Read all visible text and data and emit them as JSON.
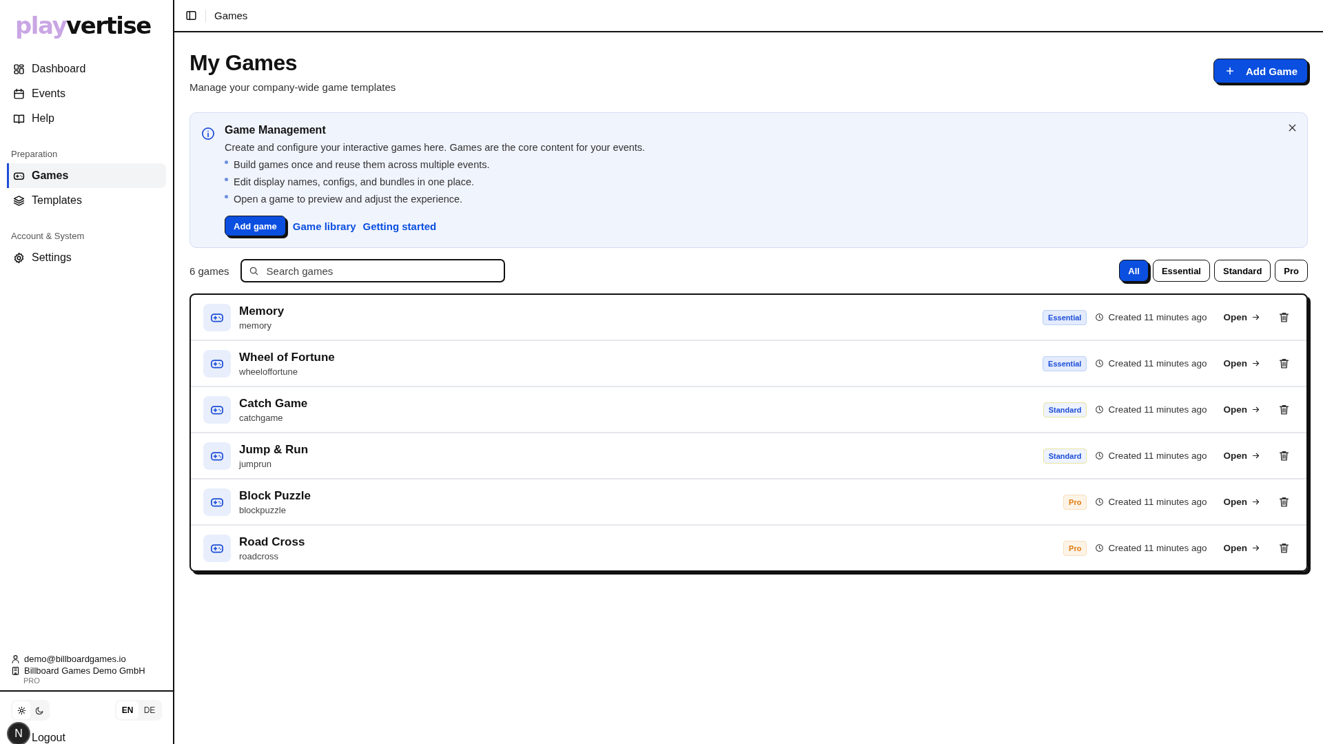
{
  "logo": {
    "part_1": "play",
    "part_2": "vertise"
  },
  "nav": [
    {
      "label": "Dashboard",
      "selected": false
    },
    {
      "label": "Events",
      "selected": false
    },
    {
      "label": "Help",
      "selected": false
    }
  ],
  "sections": [
    {
      "title": "Preparation",
      "items": [
        {
          "label": "Games",
          "selected": true
        },
        {
          "label": "Templates",
          "selected": false
        }
      ]
    },
    {
      "title": "Account & System",
      "items": [
        {
          "label": "Settings",
          "selected": false
        }
      ]
    }
  ],
  "account": {
    "email": "demo@billboardgames.io",
    "company": "Billboard Games Demo GmbH",
    "plan": "PRO"
  },
  "theme": [
    {
      "kind": "light",
      "selected": true
    },
    {
      "kind": "dark",
      "selected": false
    }
  ],
  "languages": [
    {
      "label": "EN",
      "selected": true
    },
    {
      "label": "DE",
      "selected": false
    }
  ],
  "logout": "Logout",
  "avatar": "N",
  "breadcrumb": "Games",
  "page": {
    "title": "My Games",
    "subtitle": "Manage your company-wide game templates",
    "add_button": "Add Game"
  },
  "info": {
    "title": "Game Management",
    "text": "Create and configure your interactive games here. Games are the core content for your events.",
    "bullets": [
      "Build games once and reuse them across multiple events.",
      "Edit display names, configs, and bundles in one place.",
      "Open a game to preview and adjust the experience."
    ],
    "button": "Add game",
    "links": [
      "Game library",
      "Getting started"
    ]
  },
  "count": "6 games",
  "search": {
    "placeholder": "Search games"
  },
  "filters": [
    {
      "label": "All",
      "selected": true
    },
    {
      "label": "Essential",
      "selected": false
    },
    {
      "label": "Standard",
      "selected": false
    },
    {
      "label": "Pro",
      "selected": false
    }
  ],
  "games": [
    {
      "name": "Memory",
      "slug": "memory",
      "tier": {
        "label": "Essential",
        "kind": "essential"
      },
      "created": "Created 11 minutes ago",
      "action": "Open"
    },
    {
      "name": "Wheel of Fortune",
      "slug": "wheeloffortune",
      "tier": {
        "label": "Essential",
        "kind": "essential"
      },
      "created": "Created 11 minutes ago",
      "action": "Open"
    },
    {
      "name": "Catch Game",
      "slug": "catchgame",
      "tier": {
        "label": "Standard",
        "kind": "standard"
      },
      "created": "Created 11 minutes ago",
      "action": "Open"
    },
    {
      "name": "Jump & Run",
      "slug": "jumprun",
      "tier": {
        "label": "Standard",
        "kind": "standard"
      },
      "created": "Created 11 minutes ago",
      "action": "Open"
    },
    {
      "name": "Block Puzzle",
      "slug": "blockpuzzle",
      "tier": {
        "label": "Pro",
        "kind": "pro"
      },
      "created": "Created 11 minutes ago",
      "action": "Open"
    },
    {
      "name": "Road Cross",
      "slug": "roadcross",
      "tier": {
        "label": "Pro",
        "kind": "pro"
      },
      "created": "Created 11 minutes ago",
      "action": "Open"
    }
  ]
}
